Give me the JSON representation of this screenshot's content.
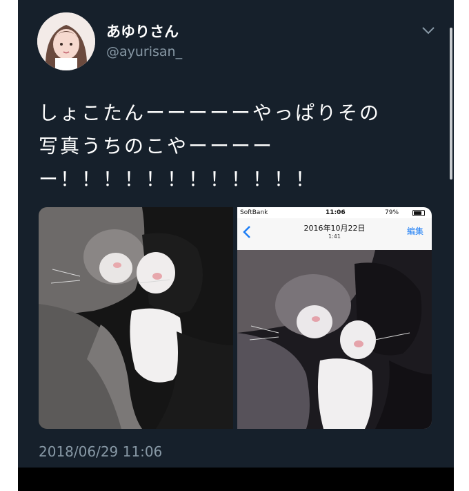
{
  "user": {
    "display_name": "あゆりさん",
    "handle": "@ayurisan_"
  },
  "tweet": {
    "text_lines": [
      "しょこたんーーーーーやっぱりその",
      "写真うちのこやーーーー",
      "ー！！！！！！！！！！！！"
    ],
    "timestamp": "2018/06/29 11:06"
  },
  "screenshot_photo": {
    "carrier": "SoftBank",
    "time": "11:06",
    "battery": "79%",
    "date_title": "2016年10月22日",
    "time_subtitle": "1:41",
    "edit_label": "編集"
  },
  "icons": {
    "menu": "chevron-down-icon",
    "back": "chevron-left-icon",
    "wifi": "wifi-icon",
    "battery": "battery-icon"
  },
  "colors": {
    "background": "#16202b",
    "primary_text": "#ffffff",
    "secondary_text": "#8899a6",
    "ios_link": "#1a7cf5"
  }
}
